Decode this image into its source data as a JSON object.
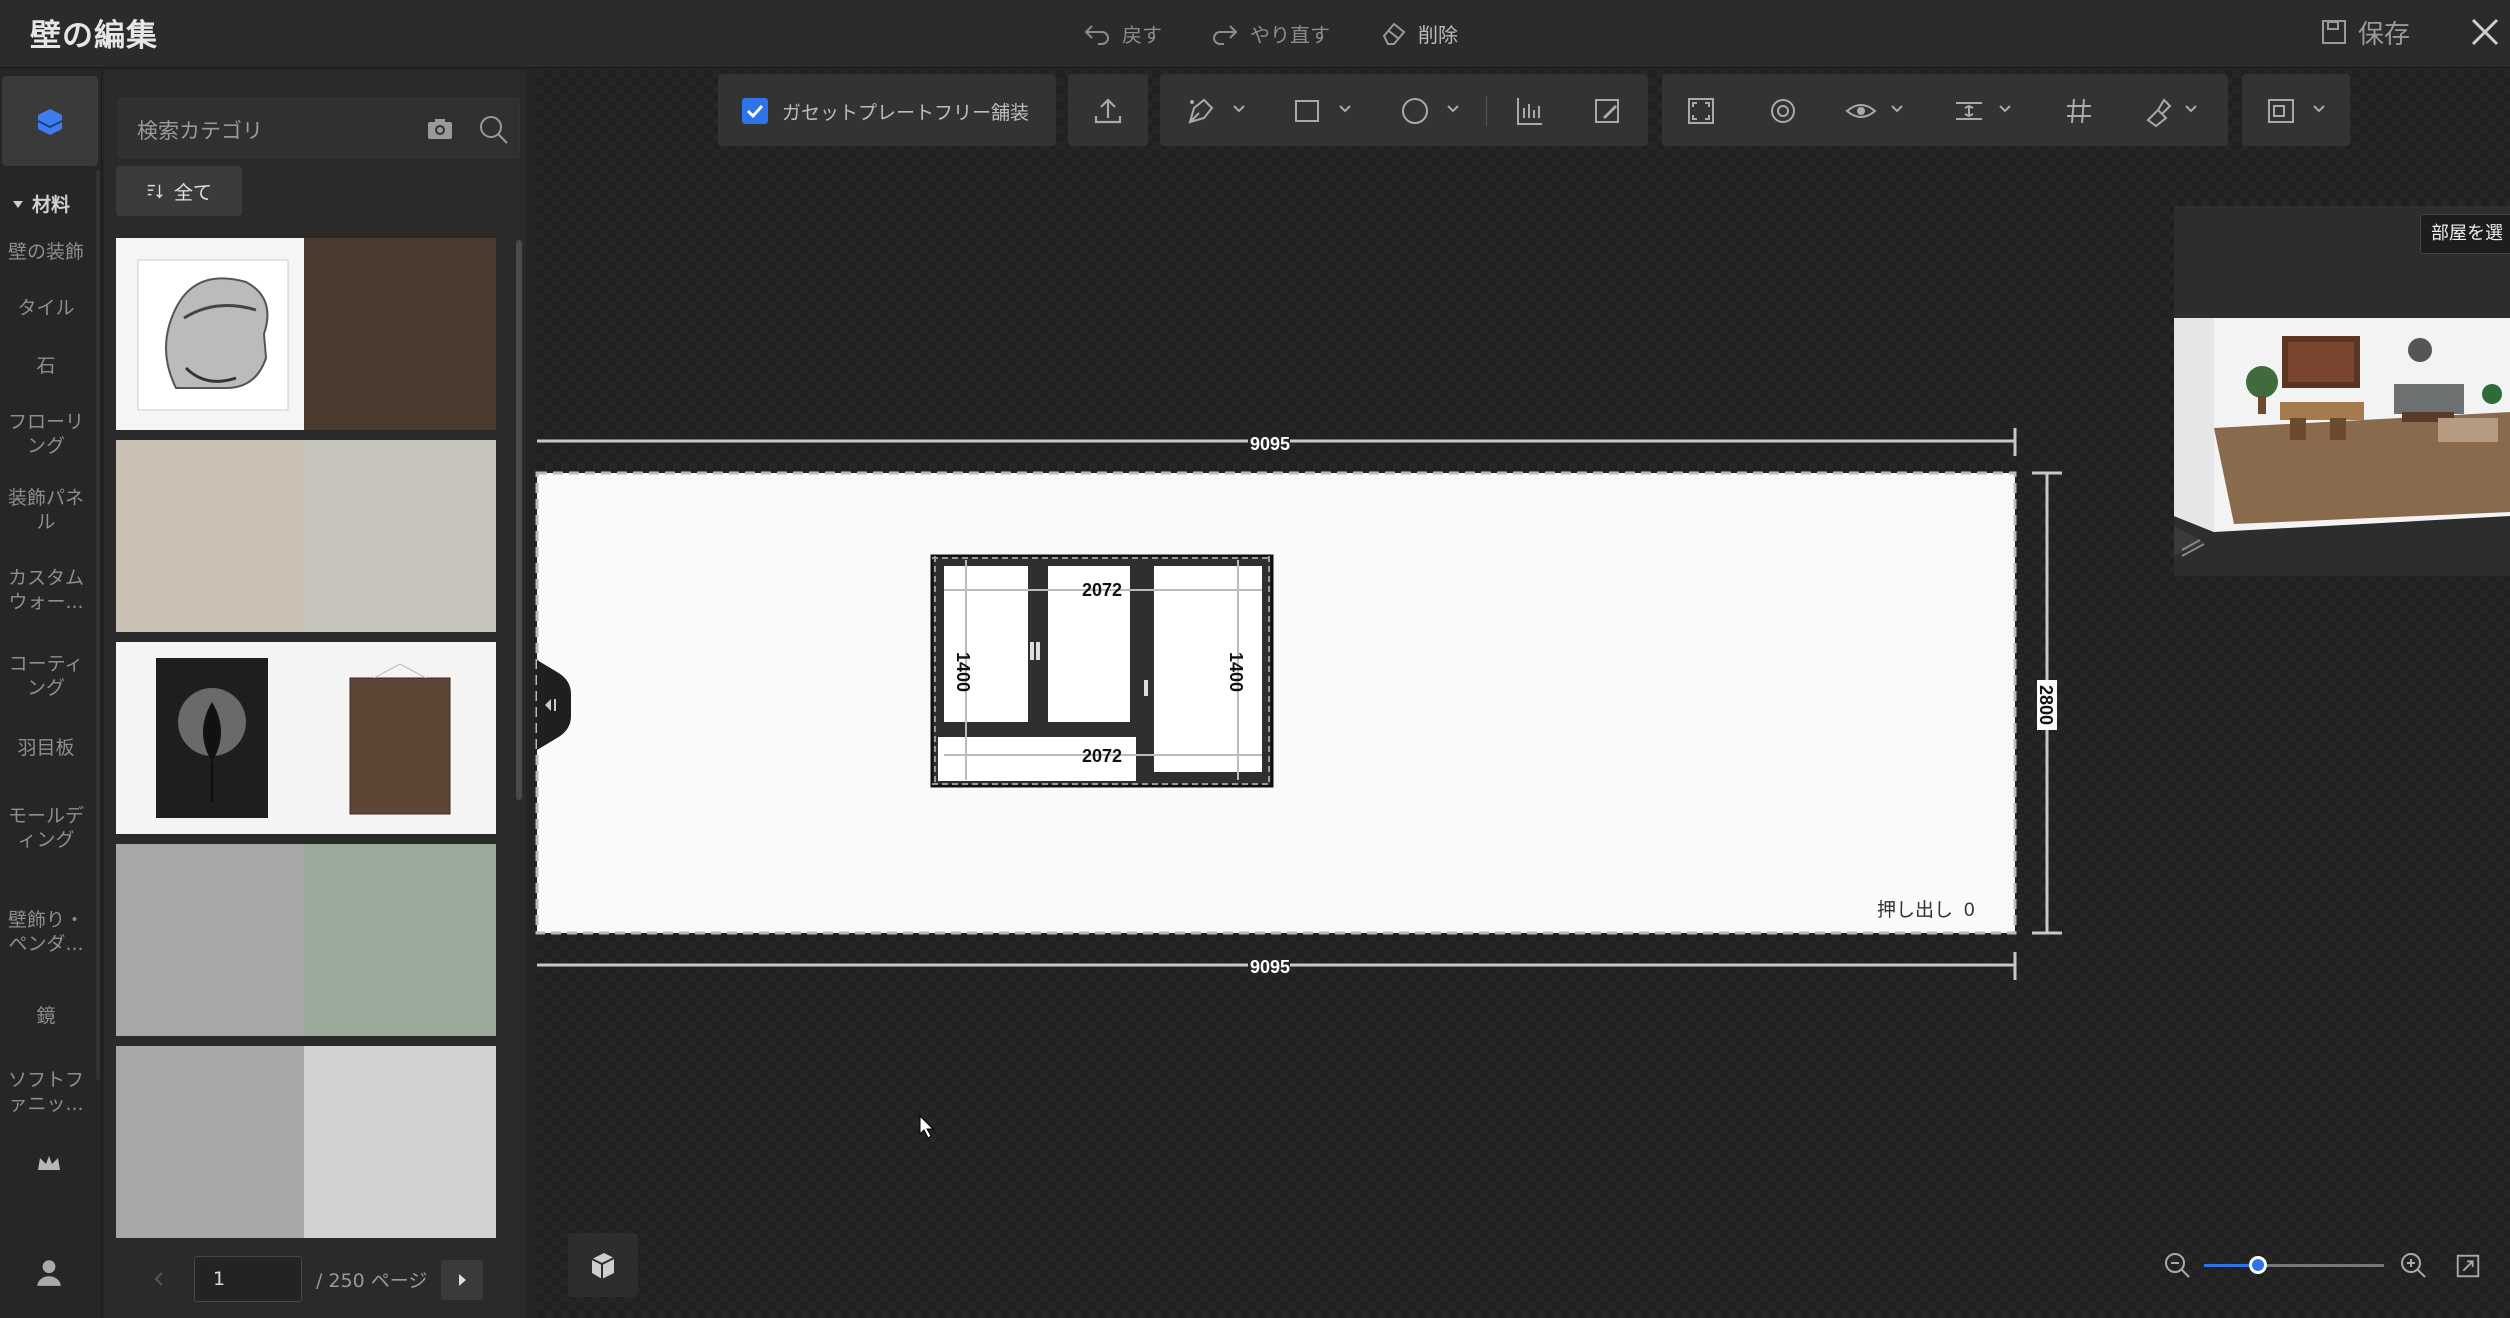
{
  "header": {
    "title": "壁の編集",
    "undo_label": "戻す",
    "redo_label": "やり直す",
    "delete_label": "削除",
    "save_label": "保存"
  },
  "rail": {
    "section_label": "材料",
    "items": [
      {
        "label": "壁の装飾"
      },
      {
        "label": "タイル"
      },
      {
        "label": "石"
      },
      {
        "label": "フローリ\nング"
      },
      {
        "label": "装飾パネ\nル"
      },
      {
        "label": "カスタム\nウォー..."
      },
      {
        "label": "コーティ\nング"
      },
      {
        "label": "羽目板"
      },
      {
        "label": "モールデ\nィング"
      },
      {
        "label": "壁飾り・\nペンダ..."
      },
      {
        "label": "鏡"
      },
      {
        "label": "ソフトフ\nァニッ..."
      }
    ],
    "icons": [
      "material-icon",
      "crown-icon",
      "user-icon"
    ]
  },
  "materials": {
    "search_placeholder": "検索カテゴリ",
    "filter_label": "全て",
    "thumbnails": [
      {
        "name": "bearded-man-sketch",
        "color": "#f2f2f2"
      },
      {
        "name": "dark-wood",
        "color": "#4b3b2f"
      },
      {
        "name": "beige-plaster",
        "color": "#c9bfb3"
      },
      {
        "name": "light-grey-wood",
        "color": "#c6c3bd"
      },
      {
        "name": "dark-leaf-art",
        "color": "#1e1e1e"
      },
      {
        "name": "brown-canvas",
        "color": "#5e4637"
      },
      {
        "name": "grey-concrete",
        "color": "#a8a8a8"
      },
      {
        "name": "sage-green",
        "color": "#9aa99a"
      },
      {
        "name": "mid-grey",
        "color": "#a7a7a7"
      },
      {
        "name": "light-grey",
        "color": "#d2d2d2"
      }
    ],
    "page_value": "1",
    "page_total": "/ 250 ページ"
  },
  "toolbar": {
    "gusset_checkbox_label": "ガセットプレートフリー舗装",
    "gusset_checked": true,
    "tools": [
      "upload-icon",
      "pen-tool-icon",
      "rectangle-icon",
      "circle-icon",
      "align-icon",
      "edit-area-icon",
      "fit-screen-icon",
      "target-icon",
      "eye-icon",
      "spacing-icon",
      "grid-icon",
      "brush-icon",
      "layout-icon"
    ]
  },
  "canvas": {
    "wall_width_top": "9095",
    "wall_width_bottom": "9095",
    "wall_height": "2800",
    "window_width_top": "2072",
    "window_width_bottom": "2072",
    "window_height_left": "1400",
    "window_height_right": "1400",
    "extrude_label": "押し出し",
    "extrude_value": "0"
  },
  "minimap": {
    "room_select_label": "部屋を選"
  },
  "zoom": {
    "level_fraction": 0.3
  },
  "colors": {
    "accent": "#2f73e8",
    "background": "#242424",
    "panel": "#2a2a2a"
  }
}
